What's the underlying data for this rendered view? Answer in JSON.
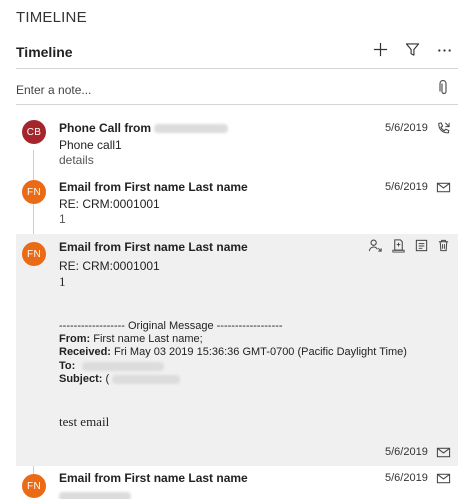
{
  "section_title": "TIMELINE",
  "panel": {
    "title": "Timeline"
  },
  "note": {
    "placeholder": "Enter a note..."
  },
  "colors": {
    "cb_avatar": "#a4262c",
    "fn_avatar": "#ea6a16"
  },
  "entries": [
    {
      "initials": "CB",
      "title": "Phone Call from",
      "date": "5/6/2019",
      "line1": "Phone call1",
      "line2": "details",
      "type_icon": "phone-call-icon"
    },
    {
      "initials": "FN",
      "title": "Email from First name Last name",
      "date": "5/6/2019",
      "line1": "RE: CRM:0001001",
      "line2": "1",
      "type_icon": "email-icon"
    },
    {
      "initials": "FN",
      "title": "Email from First name Last name",
      "date": "5/6/2019",
      "line1": "RE: CRM:0001001",
      "line2": "1",
      "original_message": "------------------ Original Message ------------------",
      "from_label": "From:",
      "from_value": "First name Last name;",
      "received_label": "Received:",
      "received_value": "Fri May 03 2019 15:36:36 GMT-0700 (Pacific Daylight Time)",
      "to_label": "To:",
      "subject_label": "Subject:",
      "subject_value": "(",
      "body": "test email",
      "type_icon": "email-icon",
      "actions": [
        "assign-icon",
        "add-to-queue-icon",
        "open-record-icon",
        "delete-icon"
      ]
    },
    {
      "initials": "FN",
      "title": "Email from First name Last name",
      "date": "5/6/2019",
      "type_icon": "email-icon"
    }
  ]
}
